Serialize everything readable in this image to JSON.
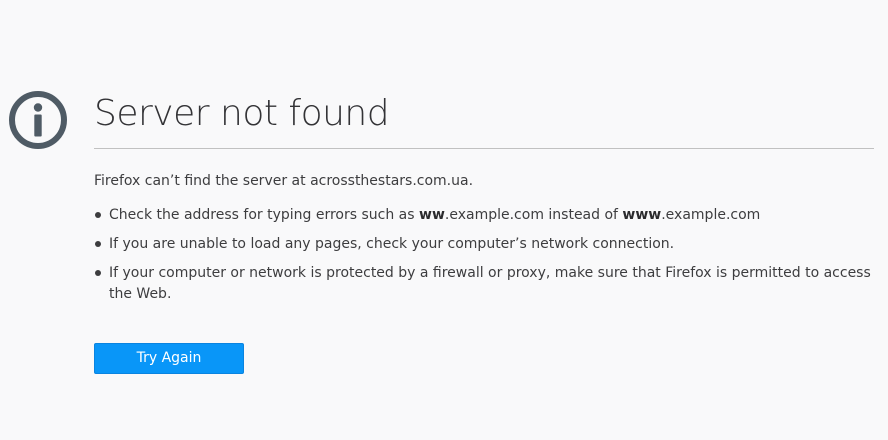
{
  "error": {
    "title": "Server not found",
    "intro": "Firefox can’t find the server at acrossthestars.com.ua.",
    "suggestions": [
      {
        "parts": [
          {
            "text": "Check the address for typing errors such as ",
            "bold": false
          },
          {
            "text": "ww",
            "bold": true
          },
          {
            "text": ".example.com instead of ",
            "bold": false
          },
          {
            "text": "www",
            "bold": true
          },
          {
            "text": ".example.com",
            "bold": false
          }
        ]
      },
      {
        "parts": [
          {
            "text": "If you are unable to load any pages, check your computer’s network connection.",
            "bold": false
          }
        ]
      },
      {
        "parts": [
          {
            "text": "If your computer or network is protected by a firewall or proxy, make sure that Firefox is permitted to access the Web.",
            "bold": false
          }
        ]
      }
    ],
    "try_again_label": "Try Again",
    "icon": "info-icon"
  },
  "colors": {
    "background": "#f9f9fa",
    "text": "#3d3d3f",
    "button": "#0996f8",
    "icon": "#4f5b65",
    "divider": "#c1c1c1"
  }
}
